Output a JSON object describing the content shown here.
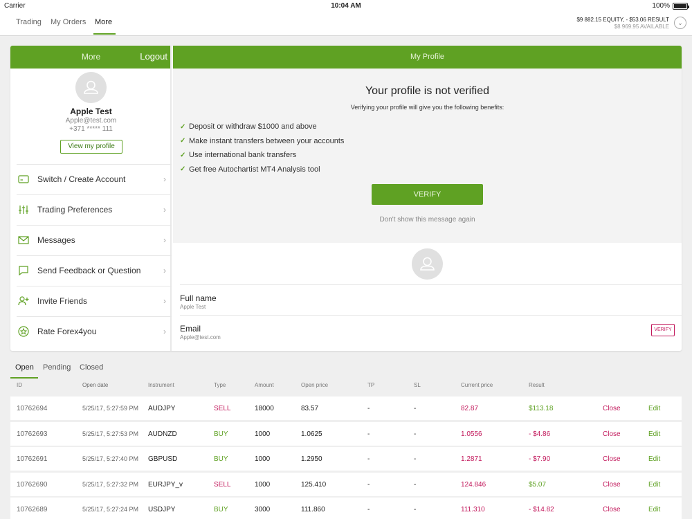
{
  "status": {
    "carrier": "Carrier",
    "time": "10:04 AM",
    "battery": "100%"
  },
  "nav": {
    "tabs": [
      "Trading",
      "My Orders",
      "More"
    ],
    "active": 2
  },
  "equity": {
    "line1": "$9 882.15 EQUITY, - $53.06 RESULT",
    "line2": "$8 969.95 AVAILABLE"
  },
  "more": {
    "title": "More",
    "logout": "Logout",
    "user_name": "Apple Test",
    "user_email": "Apple@test.com",
    "user_phone": "+371 ***** 111",
    "view_profile": "View my profile",
    "items": [
      {
        "label": "Switch / Create Account",
        "icon": "card-icon"
      },
      {
        "label": "Trading Preferences",
        "icon": "sliders-icon"
      },
      {
        "label": "Messages",
        "icon": "envelope-icon"
      },
      {
        "label": "Send Feedback or Question",
        "icon": "chat-icon"
      },
      {
        "label": "Invite Friends",
        "icon": "add-user-icon"
      },
      {
        "label": "Rate Forex4you",
        "icon": "star-icon"
      }
    ]
  },
  "profile": {
    "title": "My Profile",
    "heading": "Your profile is not verified",
    "subheading": "Verifying your profile will give you the following benefits:",
    "benefits": [
      "Deposit or withdraw $1000 and above",
      "Make instant transfers between your accounts",
      "Use international bank transfers",
      "Get free Autochartist MT4 Analysis tool"
    ],
    "verify_button": "VERIFY",
    "dont_show": "Don't show this message again",
    "fullname_label": "Full name",
    "fullname_value": "Apple Test",
    "email_label": "Email",
    "email_value": "Apple@test.com",
    "email_verify": "VERIFY"
  },
  "trades": {
    "tabs": [
      "Open",
      "Pending",
      "Closed"
    ],
    "active": 0,
    "headers": [
      "ID",
      "Open date",
      "Instrument",
      "Type",
      "Amount",
      "Open price",
      "TP",
      "SL",
      "Current price",
      "Result"
    ],
    "close_label": "Close",
    "edit_label": "Edit",
    "rows": [
      {
        "id": "10762694",
        "date": "5/25/17, 5:27:59 PM",
        "instrument": "AUDJPY",
        "type": "SELL",
        "amount": "18000",
        "open": "83.57",
        "tp": "-",
        "sl": "-",
        "current": "82.87",
        "result": "$113.18"
      },
      {
        "id": "10762693",
        "date": "5/25/17, 5:27:53 PM",
        "instrument": "AUDNZD",
        "type": "BUY",
        "amount": "1000",
        "open": "1.0625",
        "tp": "-",
        "sl": "-",
        "current": "1.0556",
        "result": "- $4.86"
      },
      {
        "id": "10762691",
        "date": "5/25/17, 5:27:40 PM",
        "instrument": "GBPUSD",
        "type": "BUY",
        "amount": "1000",
        "open": "1.2950",
        "tp": "-",
        "sl": "-",
        "current": "1.2871",
        "result": "- $7.90"
      },
      {
        "id": "10762690",
        "date": "5/25/17, 5:27:32 PM",
        "instrument": "EURJPY_v",
        "type": "SELL",
        "amount": "1000",
        "open": "125.410",
        "tp": "-",
        "sl": "-",
        "current": "124.846",
        "result": "$5.07"
      },
      {
        "id": "10762689",
        "date": "5/25/17, 5:27:24 PM",
        "instrument": "USDJPY",
        "type": "BUY",
        "amount": "3000",
        "open": "111.860",
        "tp": "-",
        "sl": "-",
        "current": "111.310",
        "result": "- $14.82"
      }
    ]
  },
  "colors": {
    "accent": "#5fa123",
    "negative": "#c2185b"
  }
}
